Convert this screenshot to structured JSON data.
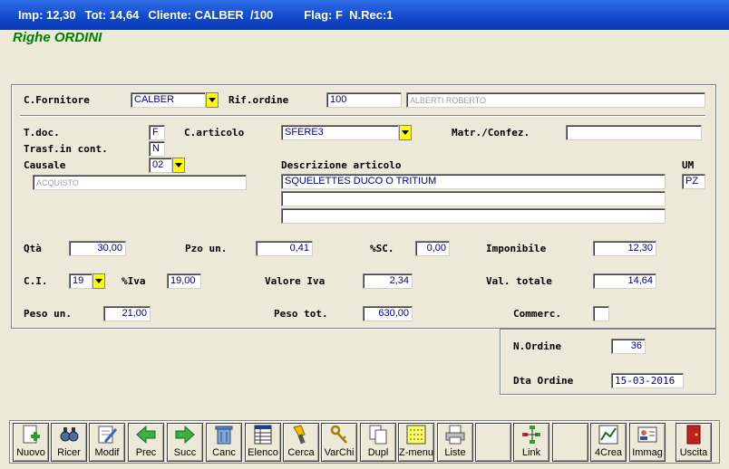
{
  "status": {
    "imp": "Imp: 12,30",
    "tot": "Tot: 14,64",
    "cliente": "Cliente: CALBER  /100",
    "flag": "Flag: F  N.Rec:1"
  },
  "form_title": "Righe ORDINI",
  "labels": {
    "fornitore": "C.Fornitore",
    "rif_ordine": "Rif.ordine",
    "tdoc": "T.doc.",
    "carticolo": "C.articolo",
    "matr": "Matr./Confez.",
    "trasf": "Trasf.in cont.",
    "causale": "Causale",
    "descr": "Descrizione articolo",
    "um": "UM",
    "qta": "Qtà",
    "pzo": "Pzo un.",
    "sc": "%SC.",
    "imponibile": "Imponibile",
    "ci": "C.I.",
    "iva": "%Iva",
    "valore_iva": "Valore Iva",
    "val_totale": "Val. totale",
    "peso_un": "Peso un.",
    "peso_tot": "Peso tot.",
    "commerc": "Commerc.",
    "n_ordine": "N.Ordine",
    "dta_ordine": "Dta Ordine"
  },
  "values": {
    "fornitore": "CALBER",
    "rif_ordine": "100",
    "rif_nome": "ALBERTI ROBERTO",
    "tdoc": "F",
    "carticolo": "SFERE3",
    "matr": "",
    "trasf": "N",
    "causale": "02",
    "causale_descr": "ACQUISTO",
    "descr1": "SQUELETTES DUCO O TRITIUM",
    "descr2": "",
    "descr3": "",
    "um": "PZ",
    "qta": "30,00",
    "pzo": "0,41",
    "sc": "0,00",
    "imponibile": "12,30",
    "ci": "19",
    "iva": "19,00",
    "valore_iva": "2,34",
    "val_totale": "14,64",
    "peso_un": "21,00",
    "peso_tot": "630,00",
    "commerc": "",
    "n_ordine": "36",
    "dta_ordine": "15-03-2016"
  },
  "toolbar": {
    "nuovo": "Nuovo",
    "ricer": "Ricer",
    "modif": "Modif",
    "prec": "Prec",
    "succ": "Succ",
    "canc": "Canc",
    "elenco": "Elenco",
    "cerca": "Cerca",
    "varchi": "VarChi",
    "dupl": "Dupl",
    "zmenu": "Z-menu",
    "liste": "Liste",
    "link": "Link",
    "crea": "4Crea",
    "immag": "Immag",
    "uscita": "Uscita"
  },
  "colors": {
    "title_bar": "#1147c9",
    "form_title": "#008000",
    "field_text": "#00008b",
    "dropdown": "#ffff00"
  }
}
